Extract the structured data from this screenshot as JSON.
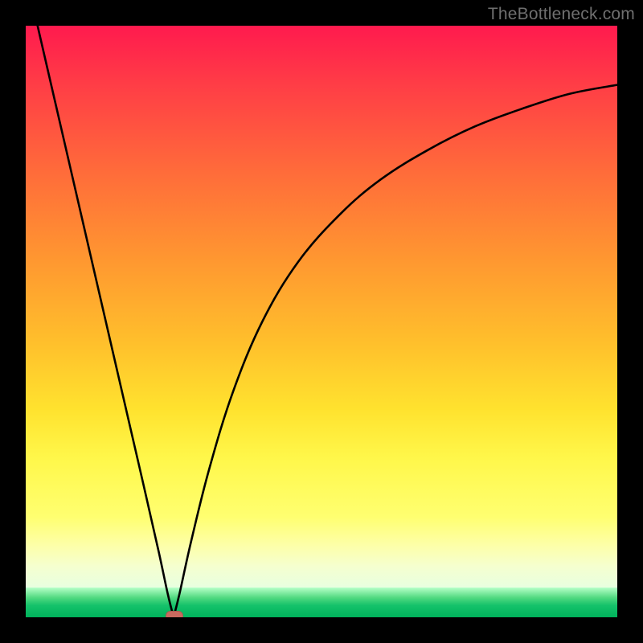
{
  "watermark": "TheBottleneck.com",
  "chart_data": {
    "type": "line",
    "title": "",
    "xlabel": "",
    "ylabel": "",
    "xlim": [
      0,
      100
    ],
    "ylim": [
      0,
      100
    ],
    "grid": false,
    "legend": false,
    "series": [
      {
        "name": "left-branch",
        "x": [
          2,
          5,
          8,
          11,
          14,
          17,
          20,
          22.5,
          24,
          25
        ],
        "y": [
          100,
          87,
          74,
          61,
          48,
          35,
          22,
          11,
          4,
          0
        ]
      },
      {
        "name": "right-branch",
        "x": [
          25,
          26,
          28,
          31,
          35,
          40,
          46,
          53,
          60,
          68,
          76,
          84,
          92,
          100
        ],
        "y": [
          0,
          4,
          13,
          25,
          38,
          50,
          60,
          68,
          74,
          79,
          83,
          86,
          88.5,
          90
        ]
      }
    ],
    "marker": {
      "x": 25,
      "y": 0,
      "color": "#c96a5f"
    },
    "background_gradient": {
      "top": "#ff1a4e",
      "mid": "#ffe22e",
      "pale": "#fdffa8",
      "bottom": "#00b35c"
    }
  }
}
